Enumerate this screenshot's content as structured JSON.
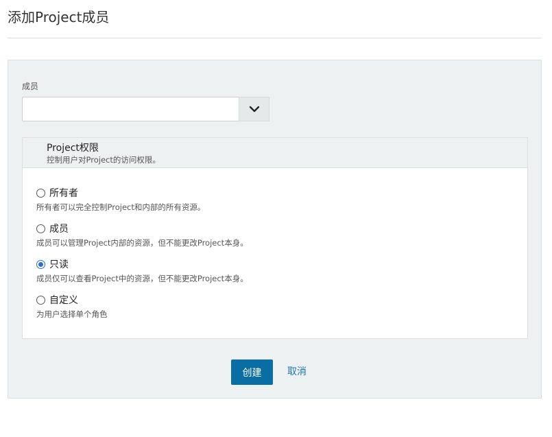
{
  "page": {
    "title": "添加Project成员"
  },
  "member": {
    "label": "成员",
    "value": "",
    "dropdown_icon": "chevron-down-icon"
  },
  "permissions": {
    "title": "Project权限",
    "subtitle": "控制用户对Project的访问权限。",
    "selected": "readonly",
    "options": [
      {
        "id": "owner",
        "label": "所有者",
        "description": "所有者可以完全控制Project和内部的所有资源。"
      },
      {
        "id": "member",
        "label": "成员",
        "description": "成员可以管理Project内部的资源，但不能更改Project本身。"
      },
      {
        "id": "readonly",
        "label": "只读",
        "description": "成员仅可以查看Project中的资源，但不能更改Project本身。"
      },
      {
        "id": "custom",
        "label": "自定义",
        "description": "为用户选择单个角色"
      }
    ]
  },
  "actions": {
    "create_label": "创建",
    "cancel_label": "取消"
  },
  "colors": {
    "primary_button": "#0a6ea4",
    "link": "#1a75b8",
    "radio_checked": "#2a6fd1",
    "panel_background": "#eef1f1"
  }
}
